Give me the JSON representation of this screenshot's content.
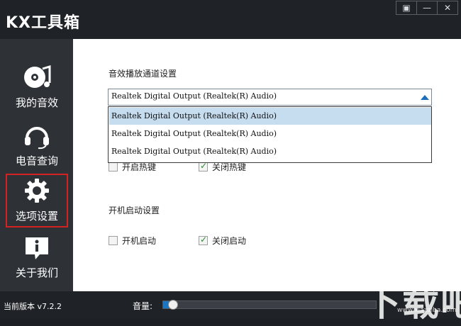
{
  "window": {
    "title": "KX工具箱",
    "buttons": [
      "▣",
      "—",
      "✕"
    ]
  },
  "sidebar": {
    "items": [
      {
        "label": "我的音效",
        "icon": "music-disc-icon",
        "active": false
      },
      {
        "label": "电音查询",
        "icon": "headset-icon",
        "active": false
      },
      {
        "label": "选项设置",
        "icon": "gear-icon",
        "active": true
      },
      {
        "label": "关于我们",
        "icon": "info-bubble-icon",
        "active": false
      }
    ]
  },
  "main": {
    "audio_channel_label": "音效播放通道设置",
    "select_value": "Realtek Digital Output (Realtek(R) Audio)",
    "dropdown_options": [
      "Realtek Digital Output (Realtek(R) Audio)",
      "Realtek Digital Output (Realtek(R) Audio)",
      "Realtek Digital Output (Realtek(R) Audio)"
    ],
    "hotkey_open": {
      "label": "开启热键",
      "checked": false
    },
    "hotkey_close": {
      "label": "关闭热键",
      "checked": true
    },
    "startup_label": "开机启动设置",
    "startup_on": {
      "label": "开机启动",
      "checked": false
    },
    "startup_off": {
      "label": "关闭启动",
      "checked": true
    }
  },
  "status": {
    "version_text": "当前版本 v7.2.2",
    "volume_label": "音量:",
    "volume_level": 0.03
  },
  "watermark": {
    "text": "下载吧",
    "url": "www.xiazaiba.com"
  },
  "colors": {
    "accent": "#1a76c2",
    "active_outline": "#d42121",
    "sidebar": "#2e3237",
    "titlebar": "#1f2226"
  }
}
